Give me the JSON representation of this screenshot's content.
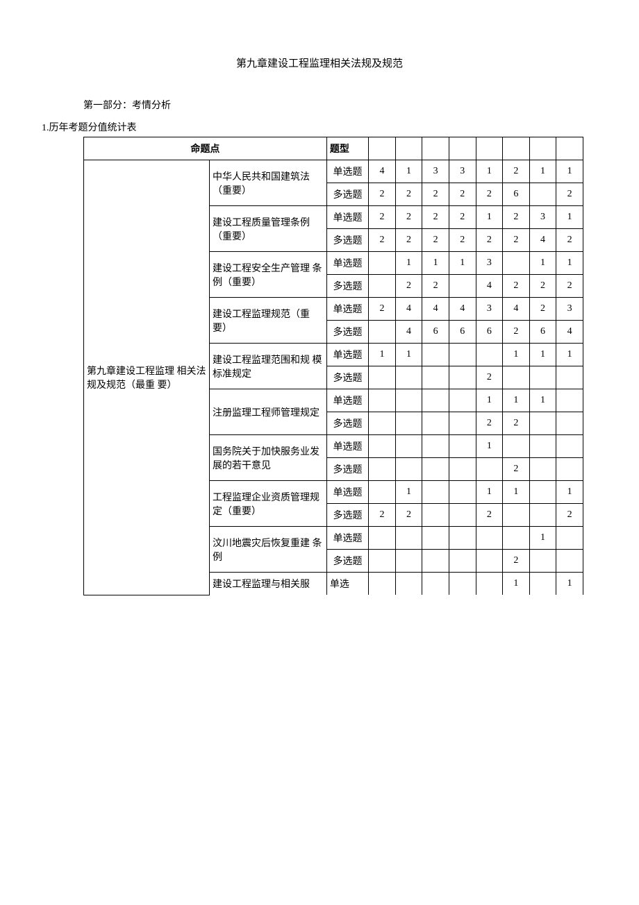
{
  "title": "第九章建设工程监理相关法规及规范",
  "section1": "第一部分：考情分析",
  "sub1": "1.历年考题分值统计表",
  "headers": {
    "topic": "命题点",
    "qtype": "题型"
  },
  "chapter_label": "第九章建设工程监理 相关法规及规范（最重 要）",
  "qtypes": {
    "single": "单选题",
    "multi": "多选题"
  },
  "rows": [
    {
      "topic": "中华人民共和国建筑法（重要）",
      "single": [
        "4",
        "1",
        "3",
        "3",
        "1",
        "2",
        "1",
        "1"
      ],
      "multi": [
        "2",
        "2",
        "2",
        "2",
        "2",
        "6",
        "",
        "2"
      ]
    },
    {
      "topic": "建设工程质量管理条例（重要）",
      "single": [
        "2",
        "2",
        "2",
        "2",
        "1",
        "2",
        "3",
        "1"
      ],
      "multi": [
        "2",
        "2",
        "2",
        "2",
        "2",
        "2",
        "4",
        "2"
      ]
    },
    {
      "topic": "建设工程安全生产管理 条例（重要）",
      "single": [
        "",
        "1",
        "1",
        "1",
        "3",
        "",
        "1",
        "1"
      ],
      "multi": [
        "",
        "2",
        "2",
        "",
        "4",
        "2",
        "2",
        "2"
      ]
    },
    {
      "topic": "建设工程监理规范（重 要）",
      "single": [
        "2",
        "4",
        "4",
        "4",
        "3",
        "4",
        "2",
        "3"
      ],
      "multi": [
        "",
        "4",
        "6",
        "6",
        "6",
        "2",
        "6",
        "4"
      ]
    },
    {
      "topic": "建设工程监理范围和规 模标准规定",
      "single": [
        "1",
        "1",
        "",
        "",
        "",
        "1",
        "1",
        "1"
      ],
      "multi": [
        "",
        "",
        "",
        "",
        "2",
        "",
        "",
        ""
      ]
    },
    {
      "topic": "注册监理工程师管理规定",
      "single": [
        "",
        "",
        "",
        "",
        "1",
        "1",
        "1",
        ""
      ],
      "multi": [
        "",
        "",
        "",
        "",
        "2",
        "2",
        "",
        ""
      ]
    },
    {
      "topic": "国务院关于加快服务业发展的若干意见",
      "single": [
        "",
        "",
        "",
        "",
        "1",
        "",
        "",
        ""
      ],
      "multi": [
        "",
        "",
        "",
        "",
        "",
        "2",
        "",
        ""
      ]
    },
    {
      "topic": "工程监理企业资质管理规定（重要）",
      "single": [
        "",
        "1",
        "",
        "",
        "1",
        "1",
        "",
        "1"
      ],
      "multi": [
        "2",
        "2",
        "",
        "",
        "2",
        "",
        "",
        "2"
      ]
    },
    {
      "topic": "汶川地震灾后恢复重建 条例",
      "single": [
        "",
        "",
        "",
        "",
        "",
        "",
        "1",
        ""
      ],
      "multi": [
        "",
        "",
        "",
        "",
        "",
        "2",
        "",
        ""
      ]
    }
  ],
  "lastrow": {
    "topic": "建设工程监理与相关服",
    "qtype": "单选",
    "vals": [
      "",
      "",
      "",
      "",
      "",
      "1",
      "",
      "1"
    ]
  }
}
